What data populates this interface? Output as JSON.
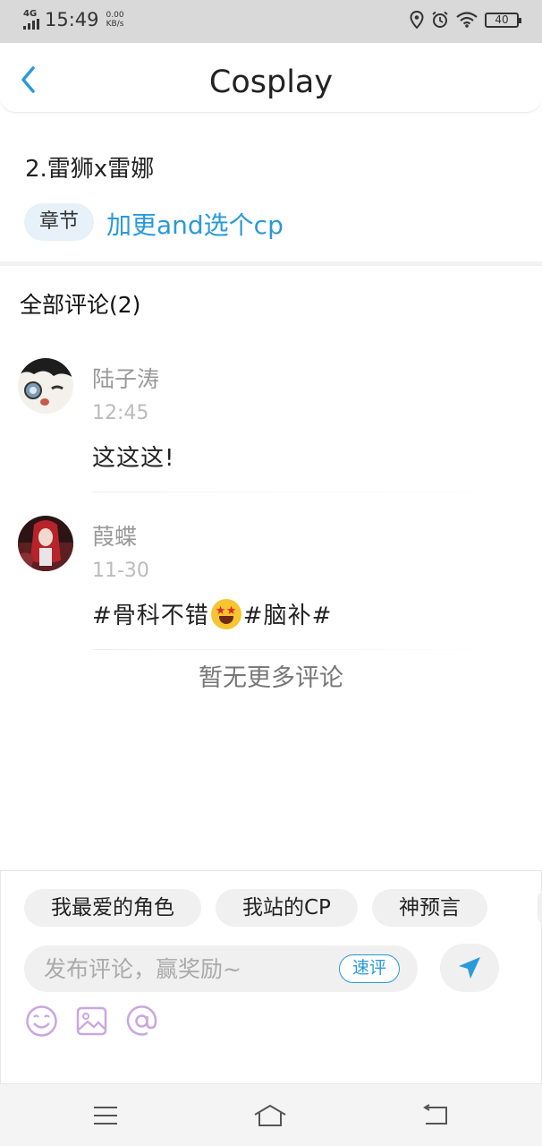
{
  "status_bar": {
    "network": "4G",
    "time": "15:49",
    "speed_value": "0.00",
    "speed_unit": "KB/s",
    "battery": "40"
  },
  "header": {
    "title": "Cosplay",
    "back_icon": "chevron-left-icon"
  },
  "chapter": {
    "title": "2.雷狮x雷娜",
    "tag": "章节",
    "link": "加更and选个cp"
  },
  "comments": {
    "header": "全部评论(2)",
    "items": [
      {
        "name": "陆子涛",
        "time": "12:45",
        "text": "这这这!"
      },
      {
        "name": "葭蝶",
        "time": "11-30",
        "text_before": "#骨科不错",
        "emoji": "star-struck-emoji",
        "text_after": "#脑补#"
      }
    ],
    "no_more": "暂无更多评论"
  },
  "quick_replies": [
    "我最爱的角色",
    "我站的CP",
    "神预言"
  ],
  "input": {
    "placeholder": "发布评论，赢奖励~",
    "quick_label": "速评",
    "send_icon": "send-icon"
  },
  "tools": [
    "emoji-icon",
    "image-icon",
    "at-icon"
  ],
  "colors": {
    "accent": "#2a9ad8",
    "tool_icon": "#c9a7e0",
    "tag_bg": "#e6f1fa"
  },
  "nav": [
    "menu-icon",
    "home-icon",
    "back-icon"
  ]
}
